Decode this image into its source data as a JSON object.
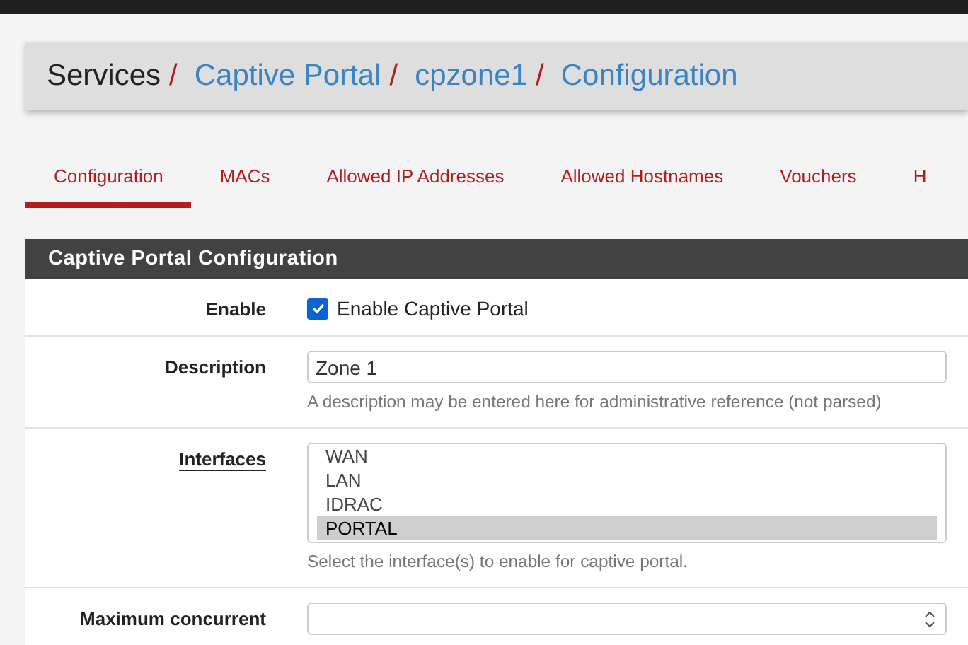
{
  "breadcrumb": [
    {
      "label": "Services",
      "link": false
    },
    {
      "separator": "/",
      "label": "Captive Portal",
      "link": true
    },
    {
      "separator": "/",
      "label": "cpzone1",
      "link": true
    },
    {
      "separator": "/",
      "label": "Configuration",
      "link": true
    }
  ],
  "tabs": [
    {
      "label": "Configuration",
      "selected": true
    },
    {
      "label": "MACs",
      "selected": false
    },
    {
      "label": "Allowed IP Addresses",
      "selected": false
    },
    {
      "label": "Allowed Hostnames",
      "selected": false
    },
    {
      "label": "Vouchers",
      "selected": false
    },
    {
      "label": "H",
      "selected": false
    }
  ],
  "panel": {
    "title": "Captive Portal Configuration",
    "rows": [
      {
        "kind": "checkbox",
        "label": "Enable",
        "text": "Enable Captive Portal",
        "checked": true
      },
      {
        "kind": "text",
        "label": "Description",
        "value": "Zone 1",
        "hint": "A description may be entered here for administrative reference (not parsed)"
      },
      {
        "kind": "multiselect",
        "label": "Interfaces",
        "options": [
          {
            "label": "WAN",
            "selected": false
          },
          {
            "label": "LAN",
            "selected": false
          },
          {
            "label": "IDRAC",
            "selected": false
          },
          {
            "label": "PORTAL",
            "selected": true
          }
        ],
        "hint": "Select the interface(s) to enable for captive portal."
      },
      {
        "kind": "number",
        "label": "Maximum concurrent",
        "value": ""
      }
    ]
  }
}
